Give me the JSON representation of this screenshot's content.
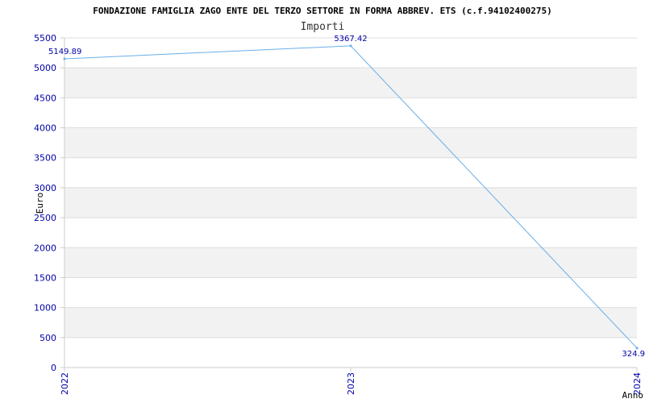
{
  "chart_data": {
    "type": "line",
    "title": "FONDAZIONE FAMIGLIA ZAGO ENTE DEL TERZO SETTORE IN FORMA ABBREV. ETS (c.f.94102400275)",
    "subtitle": "Importi",
    "xlabel": "Anno",
    "ylabel": "Euro",
    "categories": [
      "2022",
      "2023",
      "2024"
    ],
    "series": [
      {
        "values": [
          5149.89,
          5367.42,
          324.9
        ]
      }
    ],
    "data_labels": [
      "5149.89",
      "5367.42",
      "324.9"
    ],
    "yticks": [
      0,
      500,
      1000,
      1500,
      2000,
      2500,
      3000,
      3500,
      4000,
      4500,
      5000,
      5500
    ],
    "ylim": [
      0,
      5500
    ],
    "grid": "horizontal bands",
    "colors": {
      "line": "#6aaee8",
      "tick_text": "#0000aa",
      "band": "#f2f2f2",
      "grid": "#dddddd",
      "axis": "#cccccc"
    }
  }
}
